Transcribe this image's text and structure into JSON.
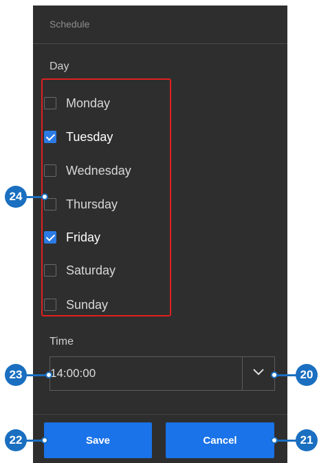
{
  "header": {
    "title": "Schedule"
  },
  "day_section": {
    "label": "Day",
    "days": [
      {
        "label": "Monday",
        "checked": false
      },
      {
        "label": "Tuesday",
        "checked": true
      },
      {
        "label": "Wednesday",
        "checked": false
      },
      {
        "label": "Thursday",
        "checked": false
      },
      {
        "label": "Friday",
        "checked": true
      },
      {
        "label": "Saturday",
        "checked": false
      },
      {
        "label": "Sunday",
        "checked": false
      }
    ]
  },
  "time_section": {
    "label": "Time",
    "value": "14:00:00"
  },
  "buttons": {
    "save": "Save",
    "cancel": "Cancel"
  },
  "callouts": {
    "days": "24",
    "time_value": "23",
    "time_dropdown": "20",
    "save": "22",
    "cancel": "21"
  },
  "colors": {
    "panel_bg": "#2e2e2e",
    "accent_blue": "#1a73e8",
    "highlight_red": "#e02020",
    "callout_blue": "#1a6fc0"
  }
}
